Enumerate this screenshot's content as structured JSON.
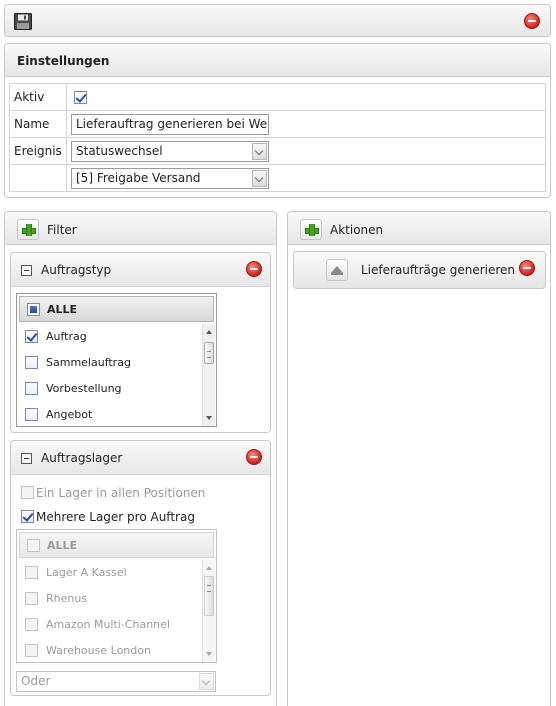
{
  "toolbar": {
    "save_icon": "floppy-disk-icon",
    "delete_icon": "delete-circle-icon"
  },
  "settings": {
    "title": "Einstellungen",
    "aktiv_label": "Aktiv",
    "aktiv_checked": true,
    "name_label": "Name",
    "name_value": "Lieferauftrag generieren bei Wech",
    "ereignis_label": "Ereignis",
    "ereignis_value": "Statuswechsel",
    "status_value": "[5] Freigabe Versand"
  },
  "filter": {
    "title": "Filter",
    "auftragstyp": {
      "title": "Auftragstyp",
      "all_label": "ALLE",
      "items": [
        {
          "label": "Auftrag",
          "checked": true
        },
        {
          "label": "Sammelauftrag",
          "checked": false
        },
        {
          "label": "Vorbestellung",
          "checked": false
        },
        {
          "label": "Angebot",
          "checked": false
        }
      ]
    },
    "auftragslager": {
      "title": "Auftragslager",
      "option1": "Ein Lager in allen Positionen",
      "option1_checked": false,
      "option2": "Mehrere Lager pro Auftrag",
      "option2_checked": true,
      "all_label": "ALLE",
      "items": [
        {
          "label": "Lager A Kassel"
        },
        {
          "label": "Rhenus"
        },
        {
          "label": "Amazon Multi-Channel"
        },
        {
          "label": "Warehouse London"
        }
      ],
      "operator_value": "Oder"
    }
  },
  "actions": {
    "title": "Aktionen",
    "items": [
      {
        "label": "Lieferaufträge generieren"
      }
    ]
  },
  "colors": {
    "delete": "#d0201a",
    "add": "#4aa020",
    "check": "#2a4d9a"
  }
}
